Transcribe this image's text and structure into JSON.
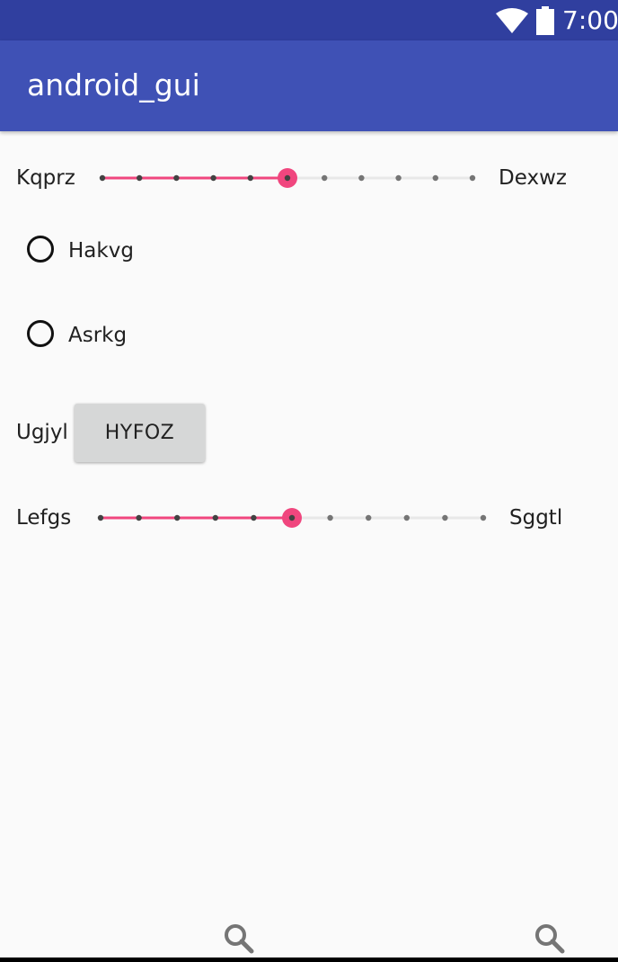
{
  "status_bar": {
    "time": "7:00",
    "icons": [
      "wifi-icon",
      "battery-icon"
    ]
  },
  "app_bar": {
    "title": "android_gui"
  },
  "slider1": {
    "left_label": "Kqprz",
    "right_label": "Dexwz",
    "value": 5,
    "max": 10
  },
  "radios": [
    {
      "label": "Hakvg",
      "checked": false
    },
    {
      "label": "Asrkg",
      "checked": false
    }
  ],
  "button_row": {
    "label": "Ugjyl",
    "button": "HYFOZ"
  },
  "slider2": {
    "left_label": "Lefgs",
    "right_label": "Sggtl",
    "value": 5,
    "max": 10
  },
  "bottom_icons": [
    "search-icon",
    "search-icon"
  ],
  "colors": {
    "status_bar": "#303f9f",
    "app_bar": "#3f51b5",
    "accent": "#f0467e",
    "background": "#fafafa"
  }
}
